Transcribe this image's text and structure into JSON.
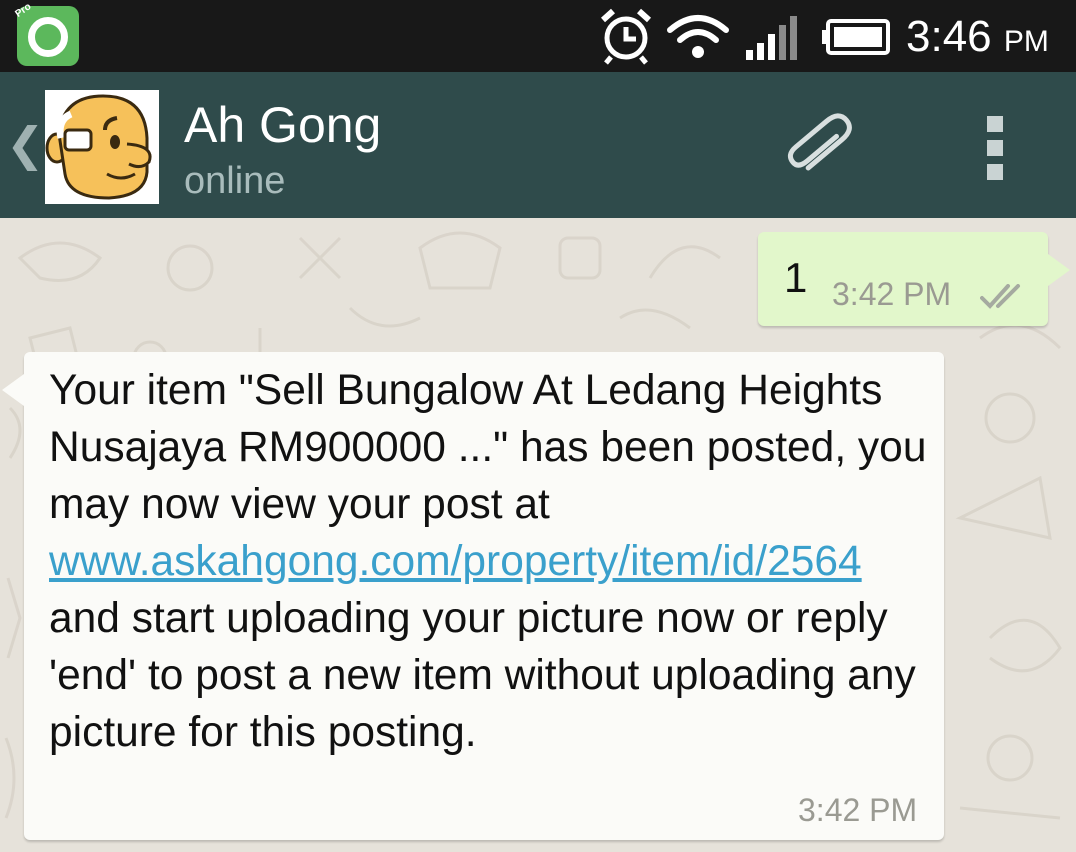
{
  "status_bar": {
    "time": "3:46",
    "ampm": "PM",
    "app_icon_badge": "Pro",
    "icons": [
      "app-notification-icon",
      "alarm-icon",
      "wifi-icon",
      "signal-icon",
      "battery-icon"
    ]
  },
  "action_bar": {
    "contact_name": "Ah Gong",
    "contact_status": "online",
    "back_icon": "chevron-left-icon",
    "attach_icon": "paperclip-icon",
    "overflow_icon": "overflow-menu-icon"
  },
  "messages": {
    "outgoing": {
      "text": "1",
      "time": "3:42 PM",
      "status_icon": "double-check-icon"
    },
    "incoming": {
      "text_before": "Your item \"Sell Bungalow At Ledang Heights Nusajaya RM900000 ...\" has been posted, you may now view your post at ",
      "link_text": "www.askahgong.com/property/item/id/2564",
      "text_after": " and start uploading your picture now or reply 'end' to post a new item without uploading any picture for this posting.",
      "time": "3:42 PM"
    }
  },
  "colors": {
    "status_bar_bg": "#181818",
    "action_bar_bg": "#2f4b4b",
    "outgoing_bubble": "#e2f7cb",
    "incoming_bubble": "#fbfbf8",
    "link": "#3aa0cc",
    "chat_bg": "#e6e2da"
  }
}
